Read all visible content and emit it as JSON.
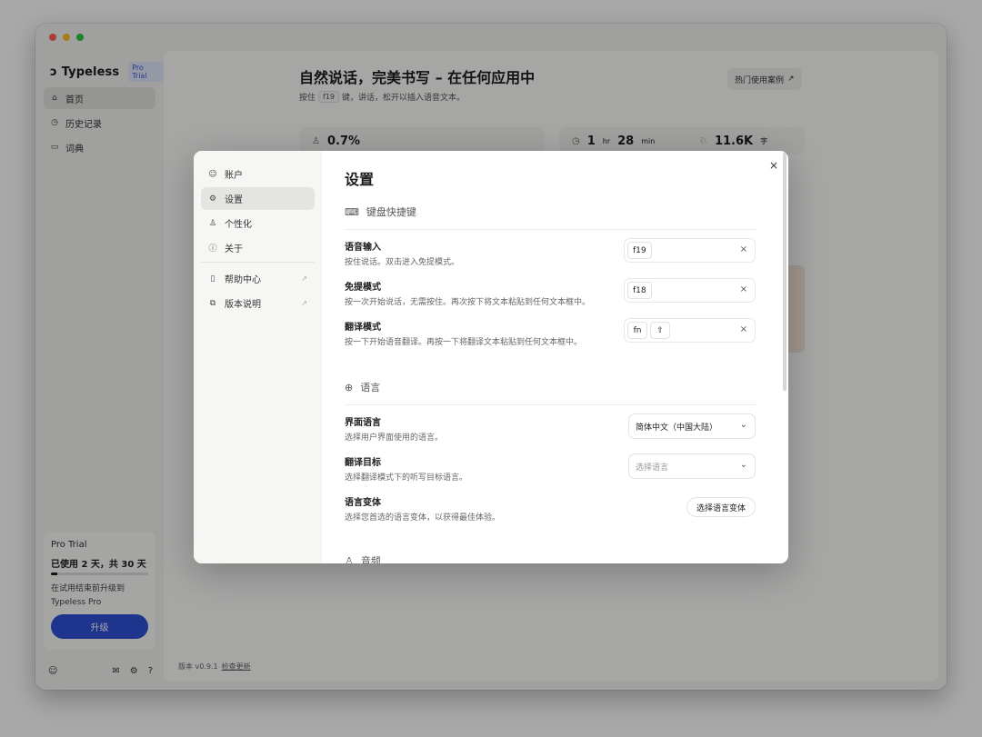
{
  "sidebar": {
    "brand_mark": "ɔ",
    "brand_name": "Typeless",
    "brand_badge": "Pro Trial",
    "items": [
      {
        "icon": "⌂",
        "label": "首页"
      },
      {
        "icon": "◷",
        "label": "历史记录"
      },
      {
        "icon": "▭",
        "label": "词典"
      }
    ],
    "trial": {
      "title": "Pro Trial",
      "used": "已使用 2 天，共 30 天",
      "progress": 0.0667,
      "desc": "在试用结束前升级到 Typeless Pro",
      "upgrade_label": "升级"
    },
    "footer": {
      "user_icon": "☺",
      "mail_icon": "✉",
      "gear_icon": "⚙",
      "help_icon": "?"
    }
  },
  "main": {
    "title": "自然说话，完美书写 – 在任何应用中",
    "subtitle_prefix": "按住",
    "subtitle_key": "f19",
    "subtitle_suffix": "键，讲话，松开以插入语音文本。",
    "popular_label": "热门使用案例",
    "popular_arrow": "↗",
    "stats": [
      {
        "icon": "♙",
        "value": "0.7%",
        "unit": ""
      },
      {
        "icon": "◷",
        "value": "1",
        "unit": "hr",
        "value2": "28",
        "unit2": "min"
      },
      {
        "icon": "♘",
        "value": "11.6K",
        "unit": "字"
      }
    ],
    "version_label": "版本 v0.9.1",
    "check_update": "检查更新"
  },
  "modal": {
    "nav": [
      {
        "icon": "☺",
        "label": "账户"
      },
      {
        "icon": "⚙",
        "label": "设置"
      },
      {
        "icon": "♙",
        "label": "个性化"
      },
      {
        "icon": "ⓘ",
        "label": "关于"
      },
      {
        "icon": "▯",
        "label": "帮助中心",
        "arrow": "↗"
      },
      {
        "icon": "⧉",
        "label": "版本说明",
        "arrow": "↗"
      }
    ],
    "title": "设置",
    "close": "×",
    "keyboard": {
      "icon": "⌨",
      "title": "键盘快捷键",
      "rows": [
        {
          "label": "语音输入",
          "desc": "按住说话。双击进入免提模式。",
          "keys": [
            "f19"
          ]
        },
        {
          "label": "免提模式",
          "desc": "按一次开始说话，无需按住。再次按下将文本粘贴到任何文本框中。",
          "keys": [
            "f18"
          ]
        },
        {
          "label": "翻译模式",
          "desc": "按一下开始语音翻译。再按一下将翻译文本粘贴到任何文本框中。",
          "keys": [
            "fn",
            "⇧"
          ]
        }
      ]
    },
    "language": {
      "icon": "⊕",
      "title": "语言",
      "ui_lang": {
        "label": "界面语言",
        "desc": "选择用户界面使用的语言。",
        "value": "简体中文（中国大陆）"
      },
      "target": {
        "label": "翻译目标",
        "desc": "选择翻译模式下的听写目标语言。",
        "placeholder": "选择语言"
      },
      "variant": {
        "label": "语言变体",
        "desc": "选择您首选的语言变体，以获得最佳体验。",
        "button": "选择语言变体"
      }
    },
    "audio": {
      "icon": "♙",
      "title": "音频"
    }
  }
}
